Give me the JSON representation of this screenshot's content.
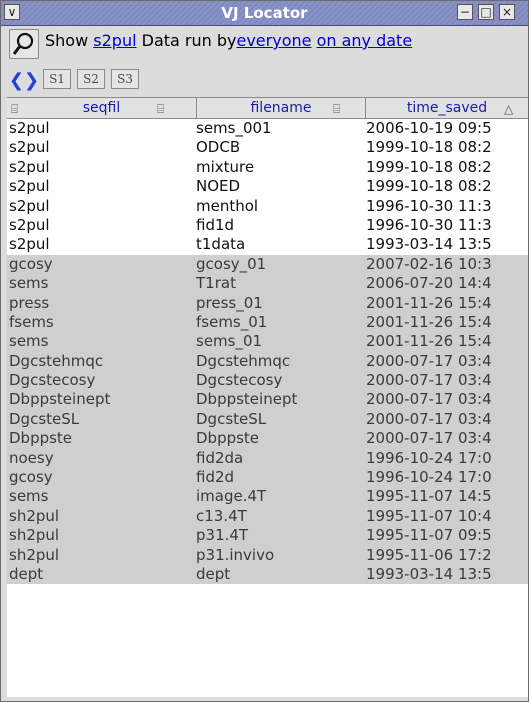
{
  "window": {
    "title": "VJ Locator"
  },
  "controls": {
    "minimize": "−",
    "maximize": "□",
    "close": "×",
    "menu": "∨"
  },
  "query": {
    "prefix": "Show ",
    "sequence_link": "s2pul",
    "middle": " Data run by",
    "user_link": "everyone",
    "date_link": "on any date"
  },
  "nav": {
    "back": "❮",
    "forward": "❯"
  },
  "shims": [
    "S1",
    "S2",
    "S3"
  ],
  "table": {
    "columns": [
      {
        "label": "seqfil",
        "sort_icon": "⌸"
      },
      {
        "label": "filename",
        "sort_icon": "⌸"
      },
      {
        "label": "time_saved",
        "sort_icon": "△"
      }
    ],
    "header_left_icon": "⌸",
    "rows": [
      [
        "s2pul",
        "sems_001",
        "2006-10-19 09:5"
      ],
      [
        "s2pul",
        "ODCB",
        "1999-10-18 08:2"
      ],
      [
        "s2pul",
        "mixture",
        "1999-10-18 08:2"
      ],
      [
        "s2pul",
        "NOED",
        "1999-10-18 08:2"
      ],
      [
        "s2pul",
        "menthol",
        "1996-10-30 11:3"
      ],
      [
        "s2pul",
        "fid1d",
        "1996-10-30 11:3"
      ],
      [
        "s2pul",
        "t1data",
        "1993-03-14 13:5"
      ],
      [
        "gcosy",
        "gcosy_01",
        "2007-02-16 10:3"
      ],
      [
        "sems",
        "T1rat",
        "2006-07-20 14:4"
      ],
      [
        "press",
        "press_01",
        "2001-11-26 15:4"
      ],
      [
        "fsems",
        "fsems_01",
        "2001-11-26 15:4"
      ],
      [
        "sems",
        "sems_01",
        "2001-11-26 15:4"
      ],
      [
        "Dgcstehmqc",
        "Dgcstehmqc",
        "2000-07-17 03:4"
      ],
      [
        "Dgcstecosy",
        "Dgcstecosy",
        "2000-07-17 03:4"
      ],
      [
        "Dbppsteinept",
        "Dbppsteinept",
        "2000-07-17 03:4"
      ],
      [
        "DgcsteSL",
        "DgcsteSL",
        "2000-07-17 03:4"
      ],
      [
        "Dbppste",
        "Dbppste",
        "2000-07-17 03:4"
      ],
      [
        "noesy",
        "fid2da",
        "1996-10-24 17:0"
      ],
      [
        "gcosy",
        "fid2d",
        "1996-10-24 17:0"
      ],
      [
        "sems",
        "image.4T",
        "1995-11-07 14:5"
      ],
      [
        "sh2pul",
        "c13.4T",
        "1995-11-07 10:4"
      ],
      [
        "sh2pul",
        "p31.4T",
        "1995-11-07 09:5"
      ],
      [
        "sh2pul",
        "p31.invivo",
        "1995-11-06 17:2"
      ],
      [
        "dept",
        "dept",
        "1993-03-14 13:5"
      ]
    ]
  }
}
